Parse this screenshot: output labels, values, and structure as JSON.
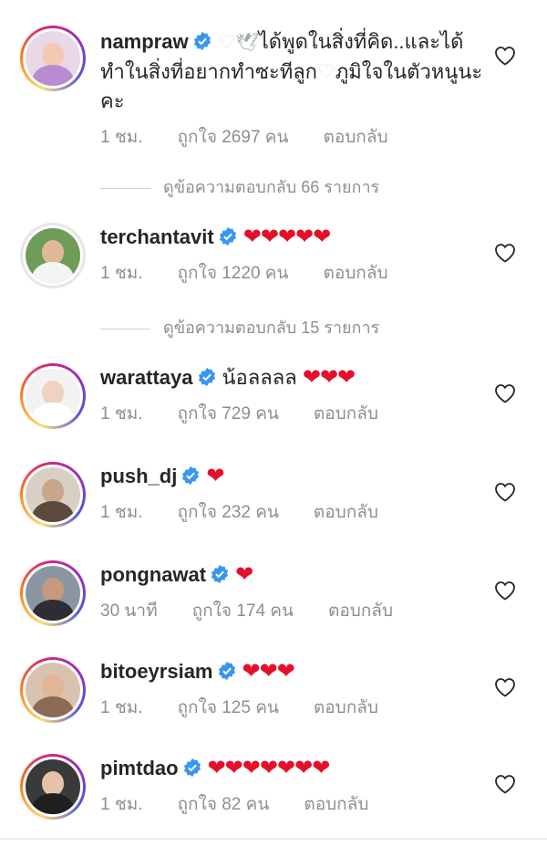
{
  "comments": [
    {
      "username": "nampraw",
      "verified": true,
      "text_before": "",
      "text": "ได้พูดในสิ่งที่คิด..และได้ทำในสิ่งที่อยากทำซะทีลูก",
      "text_after": "ภูมิใจในตัวหนูนะคะ",
      "hearts": "",
      "time": "1 ชม.",
      "likes": "ถูกใจ 2697 คน",
      "reply": "ตอบกลับ",
      "view_replies": "ดูข้อความตอบกลับ 66 รายการ"
    },
    {
      "username": "terchantavit",
      "verified": true,
      "text": "",
      "hearts": "❤❤❤❤❤",
      "time": "1 ชม.",
      "likes": "ถูกใจ 1220 คน",
      "reply": "ตอบกลับ",
      "view_replies": "ดูข้อความตอบกลับ 15 รายการ"
    },
    {
      "username": "warattaya",
      "verified": true,
      "text": "น้อลลลล",
      "hearts": "❤❤❤",
      "time": "1 ชม.",
      "likes": "ถูกใจ 729 คน",
      "reply": "ตอบกลับ"
    },
    {
      "username": "push_dj",
      "verified": true,
      "text": "",
      "hearts": "❤",
      "time": "1 ชม.",
      "likes": "ถูกใจ 232 คน",
      "reply": "ตอบกลับ"
    },
    {
      "username": "pongnawat",
      "verified": true,
      "text": "",
      "hearts": "❤",
      "time": "30 นาที",
      "likes": "ถูกใจ 174 คน",
      "reply": "ตอบกลับ"
    },
    {
      "username": "bitoeyrsiam",
      "verified": true,
      "text": "",
      "hearts": "❤❤❤",
      "time": "1 ชม.",
      "likes": "ถูกใจ 125 คน",
      "reply": "ตอบกลับ"
    },
    {
      "username": "pimtdao",
      "verified": true,
      "text": "",
      "hearts": "❤❤❤❤❤❤❤",
      "time": "1 ชม.",
      "likes": "ถูกใจ 82 คน",
      "reply": "ตอบกลับ"
    }
  ],
  "icons": {
    "verified": "verified-badge-icon",
    "like": "heart-outline-icon",
    "white_heart": "white-heart-emoji",
    "dove": "dove-emoji"
  },
  "colors": {
    "verified_blue": "#3897f0",
    "heart_red": "#e4102a",
    "meta_gray": "#8e8e8e"
  }
}
